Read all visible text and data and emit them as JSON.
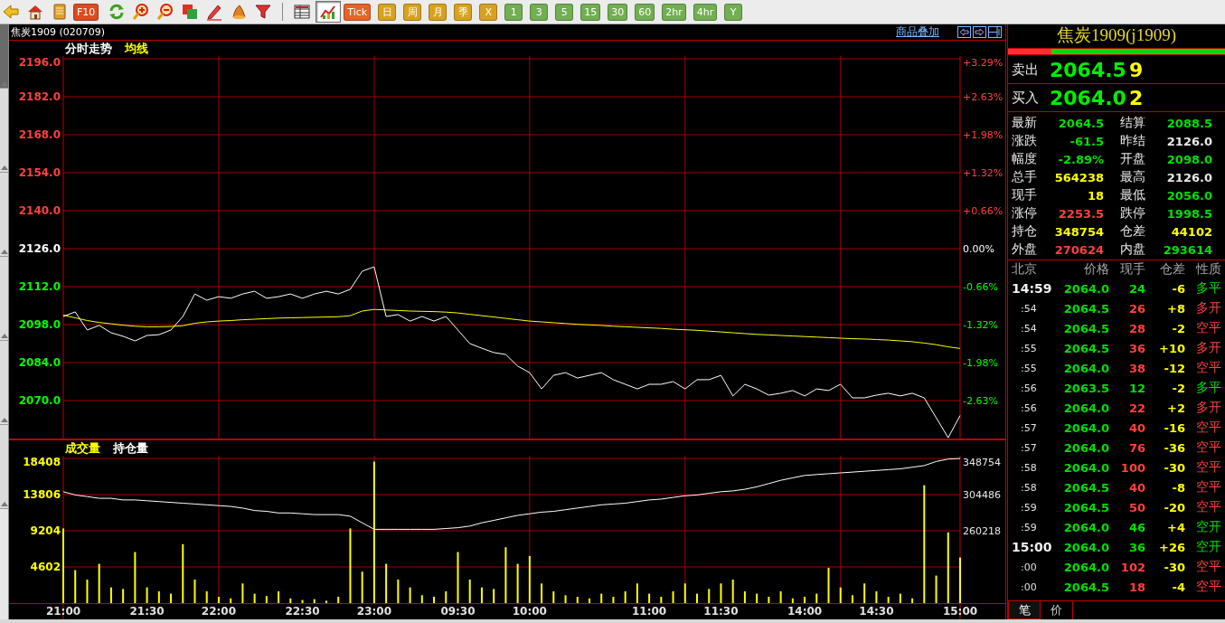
{
  "toolbar": {
    "items": [
      {
        "kind": "icon",
        "selected": false
      },
      {
        "kind": "icon",
        "selected": false
      },
      {
        "kind": "icon",
        "selected": false
      },
      {
        "kind": "label",
        "label": "F10",
        "color": "#e04a20",
        "selected": false
      },
      {
        "kind": "icon",
        "selected": false
      },
      {
        "kind": "icon",
        "selected": false
      },
      {
        "kind": "icon",
        "selected": false
      },
      {
        "kind": "icon",
        "selected": false
      },
      {
        "kind": "icon",
        "selected": false
      },
      {
        "kind": "icon",
        "selected": false
      },
      {
        "kind": "icon",
        "selected": false
      },
      {
        "kind": "separator"
      },
      {
        "kind": "icon",
        "selected": false
      },
      {
        "kind": "icon",
        "selected": true
      },
      {
        "kind": "label",
        "label": "Tick",
        "color": "#ea6228",
        "selected": false
      },
      {
        "kind": "label",
        "label": "日",
        "color": "#d8a21e",
        "selected": false
      },
      {
        "kind": "label",
        "label": "周",
        "color": "#d8a21e",
        "selected": false
      },
      {
        "kind": "label",
        "label": "月",
        "color": "#d8a21e",
        "selected": false
      },
      {
        "kind": "label",
        "label": "季",
        "color": "#d8a21e",
        "selected": false
      },
      {
        "kind": "label",
        "label": "X",
        "color": "#d8a21e",
        "selected": false
      },
      {
        "kind": "label",
        "label": "1",
        "color": "#72ae52",
        "selected": false
      },
      {
        "kind": "label",
        "label": "3",
        "color": "#72ae52",
        "selected": false
      },
      {
        "kind": "label",
        "label": "5",
        "color": "#72ae52",
        "selected": false
      },
      {
        "kind": "label",
        "label": "15",
        "color": "#72ae52",
        "selected": false
      },
      {
        "kind": "label",
        "label": "30",
        "color": "#72ae52",
        "selected": false
      },
      {
        "kind": "label",
        "label": "60",
        "color": "#72ae52",
        "selected": false
      },
      {
        "kind": "label",
        "label": "2hr",
        "color": "#72ae52",
        "selected": false
      },
      {
        "kind": "label",
        "label": "4hr",
        "color": "#72ae52",
        "selected": false
      },
      {
        "kind": "label",
        "label": "Y",
        "color": "#72ae52",
        "selected": false
      }
    ]
  },
  "side_tabs": [
    {
      "selected": true
    },
    {
      "selected": false
    },
    {
      "selected": false
    },
    {
      "selected": false
    },
    {
      "selected": false
    },
    {
      "selected": false
    }
  ],
  "header": {
    "symbol": "焦炭1909 (020709)",
    "overlay_link": "商品叠加"
  },
  "price_panel": {
    "axis": [
      {
        "change": "+3.29%",
        "color": "#ff4040"
      },
      {
        "change": "+2.63%",
        "color": "#ff4040"
      },
      {
        "change": "+1.98%",
        "color": "#ff4040"
      },
      {
        "change": "+1.32%",
        "color": "#ff4040"
      },
      {
        "change": "+0.66%",
        "color": "#ff4040"
      },
      {
        "change": "0.00%",
        "color": "#ffffff"
      },
      {
        "change": "-0.66%",
        "color": "#00ff00"
      },
      {
        "change": "-1.32%",
        "color": "#00ff00"
      },
      {
        "change": "-1.98%",
        "color": "#00ff00"
      },
      {
        "change": "-2.63%",
        "color": "#00ff00"
      }
    ],
    "chart_data": {
      "type": "line",
      "grid": true,
      "ylim": [
        2056,
        2196
      ],
      "yticks": [
        {
          "value": 2196,
          "label": "2196.0"
        },
        {
          "value": 2182,
          "label": "2182.0"
        },
        {
          "value": 2168,
          "label": "2168.0"
        },
        {
          "value": 2154,
          "label": "2154.0"
        },
        {
          "value": 2140,
          "label": "2140.0"
        },
        {
          "value": 2126,
          "label": "2126.0"
        },
        {
          "value": 2112,
          "label": "2112.0"
        },
        {
          "value": 2098,
          "label": "2098.0"
        },
        {
          "value": 2084,
          "label": "2084.0"
        },
        {
          "value": 2070,
          "label": "2070.0"
        }
      ],
      "series": [
        {
          "name": "分时走势",
          "color": "#ffffff",
          "values": [
            2101,
            2102.7,
            2096,
            2097.7,
            2095,
            2093.7,
            2092,
            2094,
            2094.3,
            2096,
            2101,
            2109.3,
            2107,
            2108.3,
            2107.7,
            2109.3,
            2110.3,
            2107.7,
            2108.3,
            2109.3,
            2107.7,
            2109.3,
            2110.3,
            2109.3,
            2111,
            2117.7,
            2119.3,
            2101,
            2101.7,
            2099.3,
            2101,
            2099.3,
            2101,
            2096,
            2091,
            2089.3,
            2087.7,
            2087,
            2082.7,
            2080.3,
            2074.3,
            2079.3,
            2080.3,
            2078.3,
            2079.3,
            2080.3,
            2077.7,
            2076,
            2074.3,
            2076,
            2076,
            2077,
            2074.3,
            2077.7,
            2077.7,
            2079.3,
            2071.7,
            2076,
            2074.3,
            2072,
            2072.7,
            2073.7,
            2071.7,
            2074.3,
            2073.7,
            2076,
            2071,
            2071,
            2072,
            2072.7,
            2071.7,
            2072.7,
            2071,
            2063.7,
            2056.3,
            2064.5
          ]
        },
        {
          "name": "均线",
          "color": "#ffff00",
          "values": [
            2101.5,
            2100.5,
            2099.5,
            2098.8,
            2098.3,
            2097.8,
            2097.4,
            2097.2,
            2097.2,
            2097.3,
            2097.6,
            2098.5,
            2099,
            2099.3,
            2099.5,
            2099.8,
            2100,
            2100.2,
            2100.4,
            2100.5,
            2100.6,
            2100.7,
            2100.8,
            2100.9,
            2101.3,
            2103,
            2103.6,
            2103.4,
            2103.2,
            2103,
            2102.9,
            2102.8,
            2102.6,
            2102.3,
            2101.8,
            2101.3,
            2100.8,
            2100.3,
            2099.8,
            2099.3,
            2099,
            2098.7,
            2098.4,
            2098.1,
            2097.9,
            2097.7,
            2097.4,
            2097.2,
            2097,
            2096.8,
            2096.6,
            2096.3,
            2096.1,
            2095.9,
            2095.6,
            2095.3,
            2095,
            2094.7,
            2094.4,
            2094.2,
            2094,
            2093.8,
            2093.6,
            2093.4,
            2093.2,
            2093,
            2092.8,
            2092.7,
            2092.5,
            2092.3,
            2092,
            2091.7,
            2091.2,
            2090.6,
            2089.8,
            2089.2
          ]
        }
      ]
    }
  },
  "volume_panel": {
    "chart_data": {
      "type": "bar",
      "grid": true,
      "categories": [
        "21:00",
        null,
        null,
        null,
        null,
        null,
        null,
        "21:30",
        null,
        null,
        null,
        null,
        null,
        "22:00",
        null,
        null,
        null,
        null,
        null,
        null,
        "22:30",
        null,
        null,
        null,
        null,
        null,
        "23:00",
        null,
        null,
        null,
        null,
        null,
        null,
        "09:30",
        null,
        null,
        null,
        null,
        null,
        "10:00",
        null,
        null,
        null,
        null,
        null,
        null,
        null,
        null,
        null,
        "11:00",
        null,
        null,
        null,
        null,
        null,
        "11:30",
        null,
        null,
        null,
        null,
        null,
        null,
        "14:00",
        null,
        null,
        null,
        null,
        null,
        "14:30",
        null,
        null,
        null,
        null,
        null,
        null,
        "15:00"
      ],
      "ylim": [
        0,
        18408
      ],
      "yticks": [
        4602,
        9204,
        13806,
        18408
      ],
      "series": [
        {
          "name": "成交量",
          "color": "#ffff00",
          "values": [
            9500,
            4200,
            3000,
            5000,
            2000,
            1800,
            6500,
            2000,
            1500,
            1200,
            7500,
            3000,
            1500,
            800,
            600,
            2500,
            1200,
            900,
            1500,
            600,
            400,
            500,
            300,
            800,
            9500,
            4000,
            18000,
            5000,
            3000,
            2000,
            1000,
            800,
            1500,
            6500,
            3000,
            2000,
            1800,
            7100,
            5000,
            6000,
            2500,
            1500,
            1000,
            800,
            600,
            1200,
            800,
            1500,
            2500,
            1200,
            800,
            1500,
            2500,
            1200,
            1800,
            2500,
            3000,
            1500,
            1200,
            800,
            1500,
            600,
            800,
            1200,
            4500,
            2000,
            1000,
            2500,
            1500,
            800,
            1200,
            600,
            15000,
            3500,
            9000,
            5800
          ]
        }
      ]
    },
    "open_interest": {
      "chart_data": {
        "type": "line",
        "ylim": [
          260218,
          348754
        ],
        "yticks": [
          260218,
          304486,
          348754
        ],
        "series": [
          {
            "name": "持仓量",
            "color": "#ffffff",
            "values": [
              308000,
              304000,
              302000,
              300000,
              300000,
              298000,
              298000,
              297000,
              296000,
              295000,
              294000,
              293000,
              292000,
              291000,
              290000,
              288000,
              285000,
              284000,
              282000,
              282000,
              281000,
              280000,
              280000,
              280000,
              278000,
              270000,
              262000,
              262000,
              262000,
              262000,
              262000,
              262000,
              263000,
              264000,
              266000,
              270000,
              273000,
              276000,
              279000,
              281000,
              283000,
              284000,
              286000,
              288000,
              290000,
              292000,
              293000,
              294000,
              296000,
              298000,
              299000,
              301000,
              303000,
              304000,
              306000,
              308000,
              309000,
              311000,
              314000,
              318000,
              322000,
              325000,
              328000,
              329000,
              330000,
              331000,
              332000,
              333000,
              334000,
              335000,
              336000,
              338000,
              340000,
              345000,
              348000,
              348754
            ]
          }
        ]
      }
    }
  },
  "quote_panel": {
    "title": "焦炭1909(j1909)",
    "ratio_bar": {
      "level": 0.2
    },
    "ask": {
      "label": "卖出",
      "price": "2064.5",
      "volume": "9"
    },
    "bid": {
      "label": "买入",
      "price": "2064.0",
      "volume": "2"
    },
    "stats": [
      {
        "label": "最新",
        "value": "2064.5",
        "color": "#00e000"
      },
      {
        "label": "结算",
        "value": "2088.5",
        "color": "#00e000"
      },
      {
        "label": "涨跌",
        "value": "-61.5",
        "color": "#00e000"
      },
      {
        "label": "昨结",
        "value": "2126.0",
        "color": "#e8e8e8"
      },
      {
        "label": "幅度",
        "value": "-2.89%",
        "color": "#00e000"
      },
      {
        "label": "开盘",
        "value": "2098.0",
        "color": "#00e000"
      },
      {
        "label": "总手",
        "value": "564238",
        "color": "#ffff00"
      },
      {
        "label": "最高",
        "value": "2126.0",
        "color": "#e8e8e8"
      },
      {
        "label": "现手",
        "value": "18",
        "color": "#ffff00"
      },
      {
        "label": "最低",
        "value": "2056.0",
        "color": "#00e000"
      },
      {
        "label": "涨停",
        "value": "2253.5",
        "color": "#ff4040"
      },
      {
        "label": "跌停",
        "value": "1998.5",
        "color": "#00e000"
      },
      {
        "label": "持仓",
        "value": "348754",
        "color": "#ffff00"
      },
      {
        "label": "仓差",
        "value": "44102",
        "color": "#ffff00"
      },
      {
        "label": "外盘",
        "value": "270624",
        "color": "#ff4040"
      },
      {
        "label": "内盘",
        "value": "293614",
        "color": "#00e000"
      }
    ],
    "trades": {
      "columns": [
        "北京",
        "价格",
        "现手",
        "仓差",
        "性质"
      ],
      "rows": [
        {
          "time": "14:59",
          "kind": "hour",
          "price": "2064.0",
          "volume": "24",
          "oi_change": "-6",
          "nature": "多平",
          "color": "#00e000"
        },
        {
          "time": ":54",
          "kind": "minute",
          "price": "2064.5",
          "volume": "26",
          "oi_change": "+8",
          "nature": "多开",
          "color": "#ff4040"
        },
        {
          "time": ":54",
          "kind": "minute",
          "price": "2064.5",
          "volume": "28",
          "oi_change": "-2",
          "nature": "空平",
          "color": "#ff4040"
        },
        {
          "time": ":55",
          "kind": "minute",
          "price": "2064.5",
          "volume": "36",
          "oi_change": "+10",
          "nature": "多开",
          "color": "#ff4040"
        },
        {
          "time": ":55",
          "kind": "minute",
          "price": "2064.0",
          "volume": "38",
          "oi_change": "-12",
          "nature": "空平",
          "color": "#ff4040"
        },
        {
          "time": ":56",
          "kind": "minute",
          "price": "2063.5",
          "volume": "12",
          "oi_change": "-2",
          "nature": "多平",
          "color": "#00e000"
        },
        {
          "time": ":56",
          "kind": "minute",
          "price": "2064.0",
          "volume": "22",
          "oi_change": "+2",
          "nature": "多开",
          "color": "#ff4040"
        },
        {
          "time": ":57",
          "kind": "minute",
          "price": "2064.0",
          "volume": "40",
          "oi_change": "-16",
          "nature": "空平",
          "color": "#ff4040"
        },
        {
          "time": ":57",
          "kind": "minute",
          "price": "2064.0",
          "volume": "76",
          "oi_change": "-36",
          "nature": "空平",
          "color": "#ff4040"
        },
        {
          "time": ":58",
          "kind": "minute",
          "price": "2064.0",
          "volume": "100",
          "oi_change": "-30",
          "nature": "空平",
          "color": "#ff4040"
        },
        {
          "time": ":58",
          "kind": "minute",
          "price": "2064.5",
          "volume": "40",
          "oi_change": "-8",
          "nature": "空平",
          "color": "#ff4040"
        },
        {
          "time": ":59",
          "kind": "minute",
          "price": "2064.5",
          "volume": "50",
          "oi_change": "-20",
          "nature": "空平",
          "color": "#ff4040"
        },
        {
          "time": ":59",
          "kind": "minute",
          "price": "2064.0",
          "volume": "46",
          "oi_change": "+4",
          "nature": "空开",
          "color": "#00e000"
        },
        {
          "time": "15:00",
          "kind": "hour",
          "price": "2064.0",
          "volume": "36",
          "oi_change": "+26",
          "nature": "空开",
          "color": "#00e000"
        },
        {
          "time": ":00",
          "kind": "minute",
          "price": "2064.0",
          "volume": "102",
          "oi_change": "-30",
          "nature": "空平",
          "color": "#ff4040"
        },
        {
          "time": ":00",
          "kind": "minute",
          "price": "2064.5",
          "volume": "18",
          "oi_change": "-4",
          "nature": "空平",
          "color": "#ff4040"
        }
      ]
    },
    "tabs": [
      {
        "label": "笔",
        "selected": true
      },
      {
        "label": "价",
        "selected": false
      }
    ]
  }
}
